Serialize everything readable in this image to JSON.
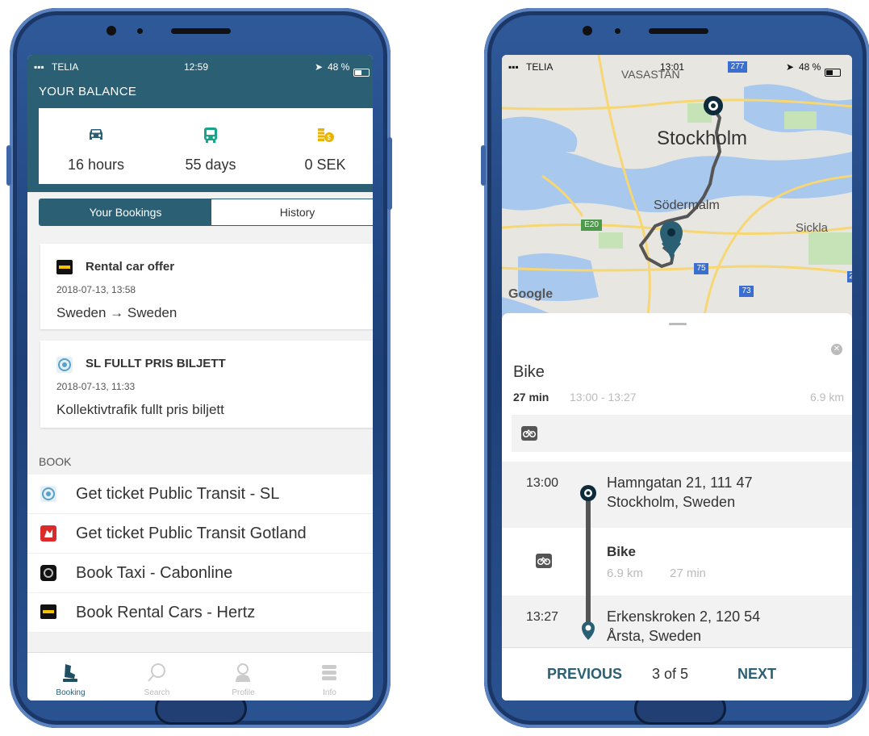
{
  "colors": {
    "accent": "#2b5f73",
    "phone": "#2a528f",
    "muted": "#bbbbbb"
  },
  "left": {
    "status": {
      "carrier": "TELIA",
      "time": "12:59",
      "battery": "48 %"
    },
    "balance": {
      "title": "YOUR BALANCE",
      "items": [
        {
          "icon": "car-icon",
          "value": "16 hours"
        },
        {
          "icon": "bus-icon",
          "value": "55 days"
        },
        {
          "icon": "coins-icon",
          "value": "0 SEK"
        }
      ]
    },
    "tabs": {
      "active": "Your Bookings",
      "inactive": "History"
    },
    "bookings": [
      {
        "logo": "hertz-logo-icon",
        "title": "Rental car offer",
        "date": "2018-07-13, 13:58",
        "detail": "Sweden → Sweden"
      },
      {
        "logo": "sl-logo-icon",
        "title": "SL FULLT PRIS BILJETT",
        "date": "2018-07-13, 11:33",
        "detail": "Kollektivtrafik fullt pris biljett"
      }
    ],
    "book_section": {
      "label": "BOOK",
      "items": [
        {
          "icon": "sl-logo-icon",
          "label": "Get ticket Public Transit - SL"
        },
        {
          "icon": "gotland-logo-icon",
          "label": "Get ticket Public Transit Gotland"
        },
        {
          "icon": "cabonline-logo-icon",
          "label": "Book Taxi - Cabonline"
        },
        {
          "icon": "hertz-logo-icon",
          "label": "Book Rental Cars - Hertz"
        }
      ]
    },
    "tabbar": [
      {
        "icon": "booking-icon",
        "label": "Booking"
      },
      {
        "icon": "search-icon",
        "label": "Search"
      },
      {
        "icon": "profile-icon",
        "label": "Profile"
      },
      {
        "icon": "info-icon",
        "label": "Info"
      }
    ]
  },
  "right": {
    "status": {
      "carrier": "TELIA",
      "time": "13:01",
      "battery": "48 %"
    },
    "map": {
      "labels": {
        "vasastan": "VASASTAN",
        "stockholm": "Stockholm",
        "sodermalm": "Södermalm",
        "sickla": "Sickla",
        "google": "Google"
      },
      "shields": {
        "s277": "277",
        "e20": "E20",
        "s75": "75",
        "s73": "73",
        "edge": "2"
      }
    },
    "leg": {
      "mode": "Bike",
      "duration": "27 min",
      "times": "13:00 - 13:27",
      "distance": "6.9 km"
    },
    "steps": [
      {
        "time": "13:00",
        "line1": "Hamngatan 21, 111 47",
        "line2": "Stockholm, Sweden"
      },
      {
        "mode": "Bike",
        "distance": "6.9 km",
        "duration": "27 min"
      },
      {
        "time": "13:27",
        "line1": "Erkenskroken 2, 120 54",
        "line2": "Årsta, Sweden"
      }
    ],
    "nav": {
      "previous": "PREVIOUS",
      "page": "3 of 5",
      "next": "NEXT"
    }
  }
}
